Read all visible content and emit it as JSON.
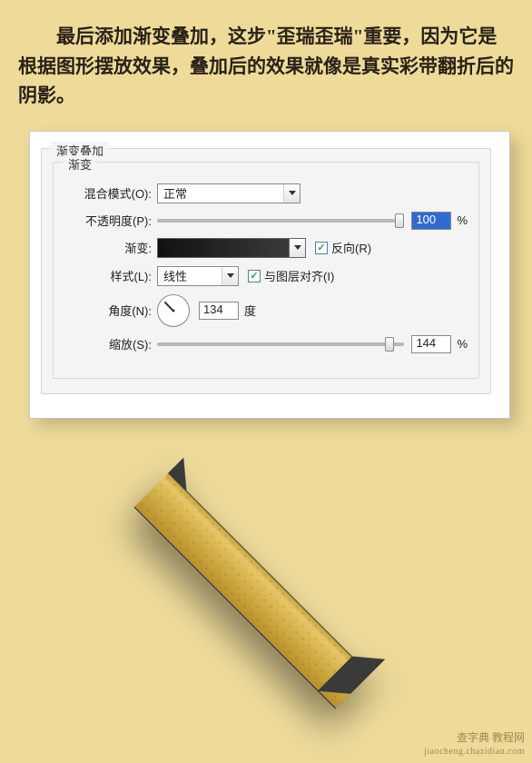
{
  "intro": "　　最后添加渐变叠加，这步\"歪瑞歪瑞\"重要，因为它是根据图形摆放效果，叠加后的效果就像是真实彩带翻折后的阴影。",
  "panel": {
    "outer_legend": "渐变叠加",
    "inner_legend": "渐变",
    "blend_mode_label": "混合模式(O):",
    "blend_mode_value": "正常",
    "opacity_label": "不透明度(P):",
    "opacity_value": "100",
    "opacity_unit": "%",
    "gradient_label": "渐变:",
    "reverse_label": "反向(R)",
    "reverse_checked": true,
    "style_label": "样式(L):",
    "style_value": "线性",
    "align_label": "与图层对齐(I)",
    "align_checked": true,
    "angle_label": "角度(N):",
    "angle_value": "134",
    "angle_unit": "度",
    "scale_label": "缩放(S):",
    "scale_value": "144",
    "scale_unit": "%"
  },
  "watermark": {
    "line1": "查字典 教程网",
    "line2": "jiaocheng.chazidian.com"
  }
}
